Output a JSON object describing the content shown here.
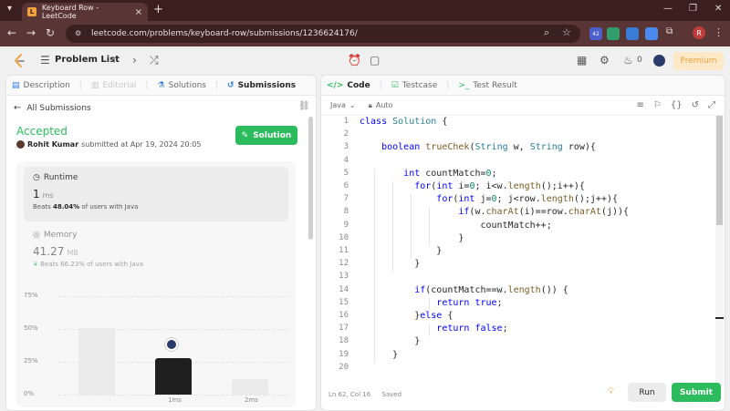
{
  "browser": {
    "tab_title": "Keyboard Row - LeetCode",
    "tab_favicon": "L",
    "new_tab": "+",
    "url": "leetcode.com/problems/keyboard-row/submissions/1236624176/",
    "profile_initial": "R",
    "ext_badge": "42"
  },
  "header": {
    "problem_list": "Problem List",
    "fire_count": "0",
    "premium": "Premium"
  },
  "left_tabs": [
    {
      "label": "Description",
      "icon": "description-icon"
    },
    {
      "label": "Editorial",
      "icon": "editorial-icon"
    },
    {
      "label": "Solutions",
      "icon": "flask-icon"
    },
    {
      "label": "Submissions",
      "icon": "history-icon"
    }
  ],
  "submission": {
    "back_label": "All Submissions",
    "status": "Accepted",
    "user": "Rohit Kumar",
    "submitted_text": "submitted at Apr 19, 2024 20:05",
    "solution_label": "Solution"
  },
  "runtime": {
    "title": "Runtime",
    "value": "1",
    "unit": "ms",
    "beats_prefix": "Beats",
    "beats_pct": "48.04%",
    "beats_suffix": "of users with Java"
  },
  "memory": {
    "title": "Memory",
    "value": "41.27",
    "unit": "MB",
    "beats_prefix": "Beats",
    "beats_pct": "66.23%",
    "beats_suffix": "of users with Java"
  },
  "chart_data": {
    "type": "bar",
    "y_ticks": [
      "75%",
      "50%",
      "25%",
      "0%"
    ],
    "ylim": [
      0,
      80
    ],
    "categories": [
      "",
      "1ms",
      "2ms"
    ],
    "values": [
      51,
      28,
      12
    ],
    "highlight_index": 1,
    "colors": {
      "normal": "#ebebeb",
      "highlight": "#1f1f1f"
    }
  },
  "right_tabs": [
    {
      "label": "Code",
      "icon": "code-icon"
    },
    {
      "label": "Testcase",
      "icon": "checkbox-icon"
    },
    {
      "label": "Test Result",
      "icon": "terminal-icon"
    }
  ],
  "editor": {
    "language": "Java",
    "mode": "Auto",
    "lines": [
      "class Solution {",
      "",
      "    boolean trueChek(String w, String row){",
      "",
      "        int countMatch=0;",
      "          for(int i=0; i<w.length();i++){",
      "              for(int j=0; j<row.length();j++){",
      "                  if(w.charAt(i)==row.charAt(j)){",
      "                      countMatch++;",
      "                  }",
      "              }",
      "          }",
      "",
      "          if(countMatch==w.length()) {",
      "              return true;",
      "          }else {",
      "              return false;",
      "          }",
      "      }",
      ""
    ],
    "status_position": "Ln 62, Col 16",
    "status_saved": "Saved"
  },
  "actions": {
    "run": "Run",
    "submit": "Submit"
  }
}
